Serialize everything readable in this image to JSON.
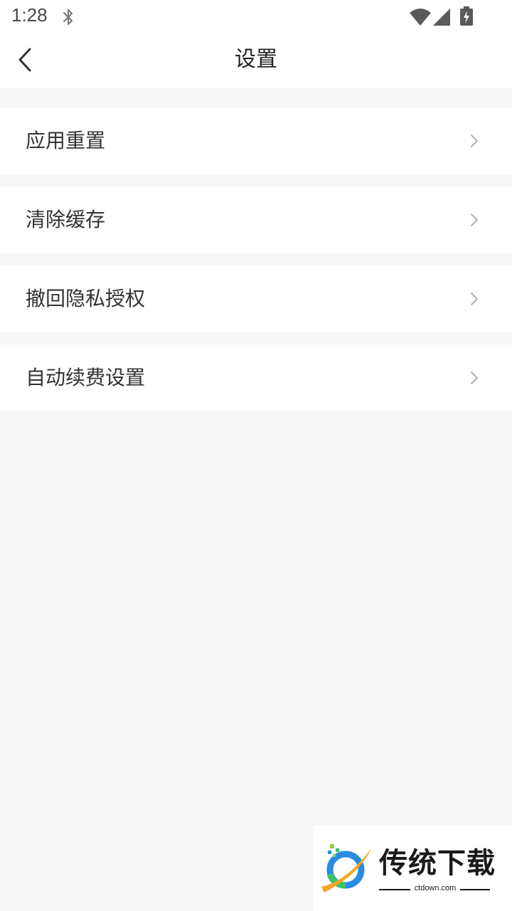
{
  "status_bar": {
    "time": "1:28",
    "icons": [
      "bluetooth-icon",
      "wifi-icon",
      "signal-icon",
      "battery-charging-icon"
    ]
  },
  "header": {
    "title": "设置",
    "back_icon": "chevron-left-icon"
  },
  "menu": {
    "items": [
      {
        "label": "应用重置"
      },
      {
        "label": "清除缓存"
      },
      {
        "label": "撤回隐私授权"
      },
      {
        "label": "自动续费设置"
      }
    ],
    "chevron_icon": "chevron-right-icon"
  },
  "watermark": {
    "brand": "传统下载",
    "domain": "ctdown.com"
  },
  "colors": {
    "background": "#f7f7f7",
    "surface": "#ffffff",
    "text_primary": "#333333",
    "chevron": "#b0b0b0"
  }
}
